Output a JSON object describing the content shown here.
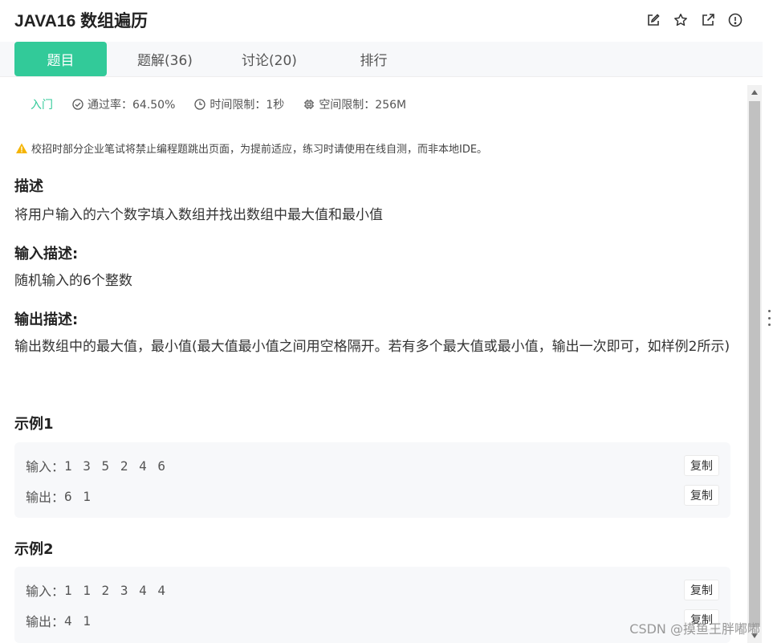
{
  "header": {
    "title": "JAVA16  数组遍历"
  },
  "tabs": [
    {
      "label": "题目"
    },
    {
      "label": "题解(36)"
    },
    {
      "label": "讨论(20)"
    },
    {
      "label": "排行"
    }
  ],
  "meta": {
    "level": "入门",
    "pass_rate": "通过率：64.50%",
    "time_limit": "时间限制：1秒",
    "memory_limit": "空间限制：256M"
  },
  "notice": "校招时部分企业笔试将禁止编程题跳出页面，为提前适应，练习时请使用在线自测，而非本地IDE。",
  "description": {
    "heading": "描述",
    "text": "将用户输入的六个数字填入数组并找出数组中最大值和最小值"
  },
  "input_desc": {
    "heading": "输入描述:",
    "text": "随机输入的6个整数"
  },
  "output_desc": {
    "heading": "输出描述:",
    "text": "输出数组中的最大值，最小值(最大值最小值之间用空格隔开。若有多个最大值或最小值，输出一次即可，如样例2所示)"
  },
  "examples": [
    {
      "heading": "示例1",
      "input_label": "输入：",
      "input_value": "1 3 5 2 4 6",
      "output_label": "输出：",
      "output_value": "6 1",
      "copy_label": "复制"
    },
    {
      "heading": "示例2",
      "input_label": "输入：",
      "input_value": "1 1 2 3 4 4",
      "output_label": "输出：",
      "output_value": "4 1",
      "copy_label": "复制"
    }
  ],
  "watermark": "CSDN @摸鱼王胖嘟嘟",
  "colors": {
    "accent": "#32ca99",
    "warning": "#f5b400"
  }
}
